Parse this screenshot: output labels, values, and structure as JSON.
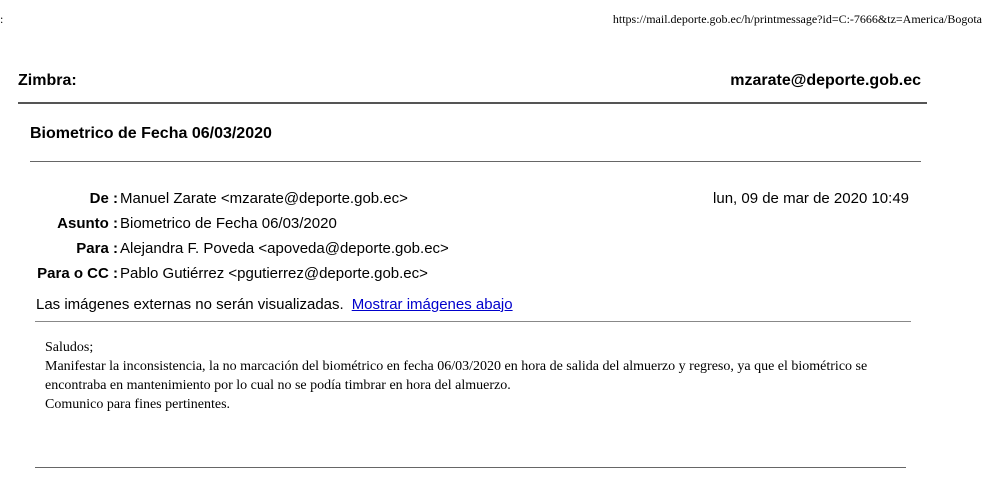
{
  "print": {
    "url": "https://mail.deporte.gob.ec/h/printmessage?id=C:-7666&tz=America/Bogota",
    "corner_mark": ":"
  },
  "header_bar": {
    "app_name": "Zimbra:",
    "account": "mzarate@deporte.gob.ec"
  },
  "message": {
    "title": "Biometrico de Fecha 06/03/2020",
    "from_label": "De :",
    "from_value": "Manuel Zarate <mzarate@deporte.gob.ec>",
    "date": "lun, 09 de mar de 2020 10:49",
    "subject_label": "Asunto :",
    "subject_value": "Biometrico de Fecha 06/03/2020",
    "to_label": "Para :",
    "to_value": "Alejandra F. Poveda <apoveda@deporte.gob.ec>",
    "cc_label": "Para o CC :",
    "cc_value": "Pablo Gutiérrez <pgutierrez@deporte.gob.ec>",
    "images_notice": "Las imágenes externas no serán visualizadas.",
    "show_images_link": "Mostrar imágenes abajo",
    "body": [
      "Saludos;",
      "Manifestar la inconsistencia, la no marcación del biométrico en fecha 06/03/2020 en hora de salida del almuerzo y regreso, ya que el biométrico se encontraba en mantenimiento por lo cual no se podía timbrar en hora del almuerzo.",
      "Comunico para fines pertinentes."
    ]
  },
  "colors": {
    "link": "#0000cc",
    "rule": "#666666"
  }
}
